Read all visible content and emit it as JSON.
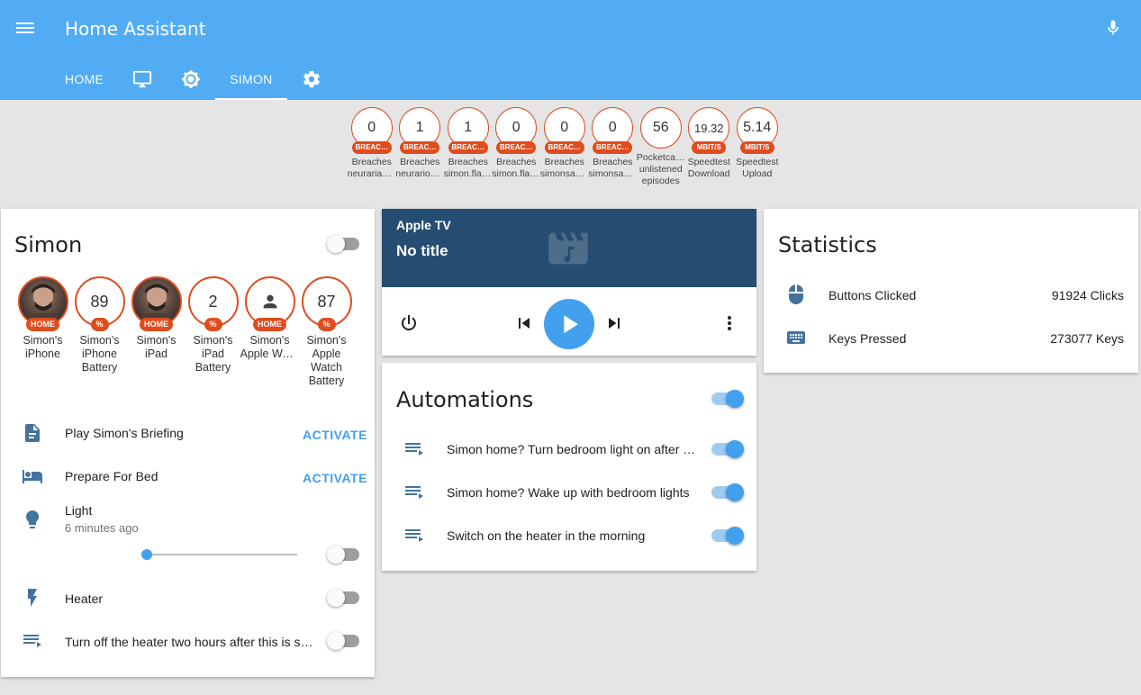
{
  "header": {
    "title": "Home Assistant",
    "tabs": [
      {
        "label": "HOME",
        "icon": "text"
      },
      {
        "label": "",
        "icon": "monitor-icon"
      },
      {
        "label": "",
        "icon": "brightness-icon"
      },
      {
        "label": "SIMON",
        "icon": "text"
      },
      {
        "label": "",
        "icon": "settings-icon"
      }
    ]
  },
  "badges": [
    {
      "value": "0",
      "unit": "BREAC…",
      "label1": "Breaches",
      "label2": "neuraria@…"
    },
    {
      "value": "1",
      "unit": "BREAC…",
      "label1": "Breaches",
      "label2": "neurario@…"
    },
    {
      "value": "1",
      "unit": "BREAC…",
      "label1": "Breaches",
      "label2": "simon.flav…"
    },
    {
      "value": "0",
      "unit": "BREAC…",
      "label1": "Breaches",
      "label2": "simon.flav…"
    },
    {
      "value": "0",
      "unit": "BREAC…",
      "label1": "Breaches",
      "label2": "simonsay…"
    },
    {
      "value": "0",
      "unit": "BREAC…",
      "label1": "Breaches",
      "label2": "simonsay…"
    },
    {
      "value": "56",
      "unit": "",
      "label1": "Pocketcas…",
      "label2": "unlistened",
      "label3": "episodes"
    },
    {
      "value": "19.32",
      "unit": "MBIT/S",
      "label1": "Speedtest",
      "label2": "Download"
    },
    {
      "value": "5.14",
      "unit": "MBIT/S",
      "label1": "Speedtest",
      "label2": "Upload"
    }
  ],
  "simon_card": {
    "title": "Simon",
    "people": [
      {
        "value": "",
        "unit": "HOME",
        "label": [
          "Simon's",
          "iPhone"
        ]
      },
      {
        "value": "89",
        "unit": "%",
        "label": [
          "Simon's",
          "iPhone",
          "Battery"
        ]
      },
      {
        "value": "",
        "unit": "HOME",
        "label": [
          "Simon's",
          "iPad"
        ]
      },
      {
        "value": "2",
        "unit": "%",
        "label": [
          "Simon's",
          "iPad",
          "Battery"
        ]
      },
      {
        "value": "",
        "unit": "HOME",
        "label": [
          "Simon's",
          "Apple Wat…"
        ]
      },
      {
        "value": "87",
        "unit": "%",
        "label": [
          "Simon's",
          "Apple",
          "Watch",
          "Battery"
        ]
      }
    ],
    "entities": {
      "briefing": {
        "name": "Play Simon's Briefing",
        "action": "ACTIVATE"
      },
      "bed": {
        "name": "Prepare For Bed",
        "action": "ACTIVATE"
      },
      "light": {
        "name": "Light",
        "sub": "6 minutes ago"
      },
      "heater": {
        "name": "Heater"
      },
      "heater_off": {
        "name": "Turn off the heater two hours after this is s…"
      }
    }
  },
  "media_card": {
    "app": "Apple TV",
    "title": "No title"
  },
  "automations": {
    "title": "Automations",
    "items": [
      {
        "name": "Simon home? Turn bedroom light on after …"
      },
      {
        "name": "Simon home? Wake up with bedroom lights"
      },
      {
        "name": "Switch on the heater in the morning"
      }
    ]
  },
  "statistics": {
    "title": "Statistics",
    "rows": [
      {
        "name": "Buttons Clicked",
        "value": "91924 Clicks"
      },
      {
        "name": "Keys Pressed",
        "value": "273077 Keys"
      }
    ]
  },
  "colors": {
    "header": "#52acf3",
    "accent": "#42a0ee",
    "badge": "#df4c1e",
    "media_bg": "#254d71"
  }
}
